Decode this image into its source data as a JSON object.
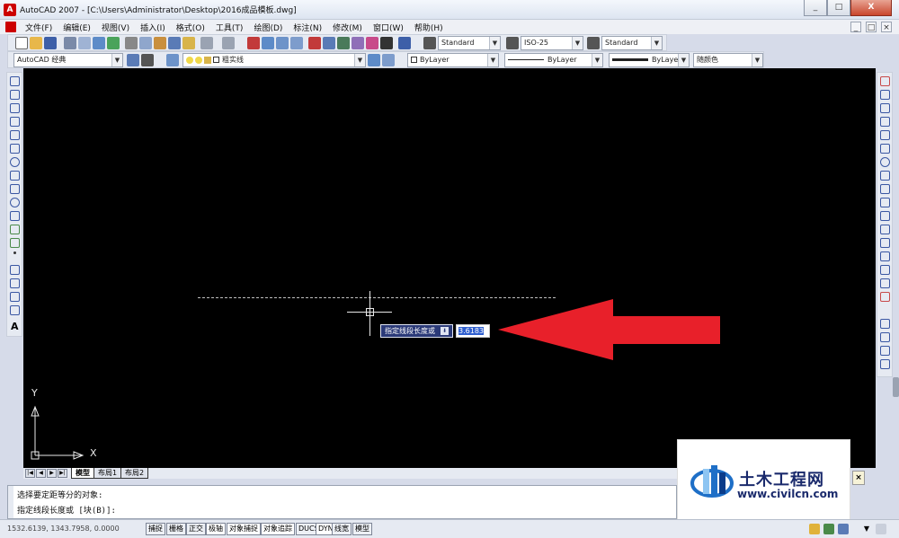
{
  "window": {
    "title": "AutoCAD 2007 - [C:\\Users\\Administrator\\Desktop\\2016成品模板.dwg]",
    "app_icon": "autocad-logo",
    "minimize_label": "_",
    "maximize_label": "□",
    "close_label": "X"
  },
  "menu": {
    "items": [
      "文件(F)",
      "编辑(E)",
      "视图(V)",
      "插入(I)",
      "格式(O)",
      "工具(T)",
      "绘图(D)",
      "标注(N)",
      "修改(M)",
      "窗口(W)",
      "帮助(H)"
    ],
    "doc_min": "_",
    "doc_restore": "□",
    "doc_close": "×"
  },
  "toolbar": {
    "text_style": "Standard",
    "dim_style": "ISO-25",
    "table_style": "Standard",
    "workspace": "AutoCAD 经典",
    "layer": "粗实线",
    "color": "ByLayer",
    "linetype": "ByLayer",
    "lineweight": "ByLayer",
    "plot_style": "随颜色"
  },
  "drawing": {
    "prompt": "指定线段长度或",
    "prompt_dropdown": "⬇",
    "input_value": "3.6183",
    "ucs_x": "X",
    "ucs_y": "Y"
  },
  "tabs": {
    "nav": [
      "|◀",
      "◀",
      "▶",
      "▶|"
    ],
    "items": [
      "模型",
      "布局1",
      "布局2"
    ],
    "active": "模型"
  },
  "command": {
    "line1": "选择要定距等分的对象:",
    "line2": "指定线段长度或 [块(B)]:"
  },
  "watermark": {
    "title": "土木工程网",
    "url": "www.civilcn.com",
    "close": "×"
  },
  "status": {
    "coords": "1532.6139, 1343.7958, 0.0000",
    "buttons": [
      "捕捉",
      "栅格",
      "正交",
      "极轴",
      "对象捕捉",
      "对象追踪",
      "DUCS",
      "DYN",
      "线宽",
      "模型"
    ]
  },
  "colors": {
    "canvas": "#000000",
    "arrow": "#e8202a",
    "ui": "#e6eaf2"
  }
}
